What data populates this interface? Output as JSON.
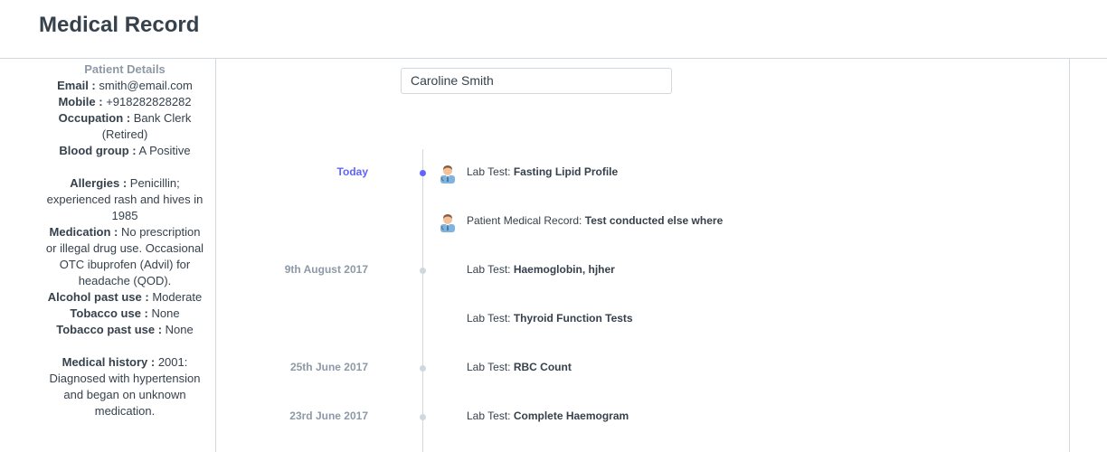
{
  "header": {
    "title": "Medical Record"
  },
  "sidebar": {
    "section_title": "Patient Details",
    "email_label": "Email :",
    "email": "smith@email.com",
    "mobile_label": "Mobile :",
    "mobile": "+918282828282",
    "occupation_label": "Occupation :",
    "occupation": "Bank Clerk (Retired)",
    "blood_label": "Blood group :",
    "blood": "A Positive",
    "allergies_label": "Allergies :",
    "allergies": "Penicillin; experienced rash and hives in 1985",
    "medication_label": "Medication :",
    "medication": "No prescription or illegal drug use. Occasional OTC ibuprofen (Advil) for headache (QOD).",
    "alcohol_label": "Alcohol past use :",
    "alcohol": "Moderate",
    "tobacco_label": "Tobacco use :",
    "tobacco": "None",
    "tobacco_past_label": "Tobacco past use :",
    "tobacco_past": "None",
    "history_label": "Medical history :",
    "history": "2001: Diagnosed with hypertension and began on unknown medication."
  },
  "patient_field": {
    "value": "Caroline Smith"
  },
  "timeline": [
    {
      "date": "Today",
      "prefix": "Lab Test:",
      "title": "Fasting Lipid Profile",
      "avatar": "doctor-avatar-icon"
    },
    {
      "date": "",
      "prefix": "Patient Medical Record:",
      "title": "Test conducted else where",
      "avatar": "doctor-avatar-icon"
    },
    {
      "date": "9th August 2017",
      "prefix": "Lab Test:",
      "title": "Haemoglobin, hjher",
      "avatar": ""
    },
    {
      "date": "",
      "prefix": "Lab Test:",
      "title": "Thyroid Function Tests",
      "avatar": ""
    },
    {
      "date": "25th June 2017",
      "prefix": "Lab Test:",
      "title": "RBC Count",
      "avatar": ""
    },
    {
      "date": "23rd June 2017",
      "prefix": "Lab Test:",
      "title": "Complete Haemogram",
      "avatar": ""
    }
  ],
  "colors": {
    "accent": "#5e64ff",
    "muted": "#8d99a6",
    "border": "#d1d8dd",
    "text": "#36414c"
  }
}
